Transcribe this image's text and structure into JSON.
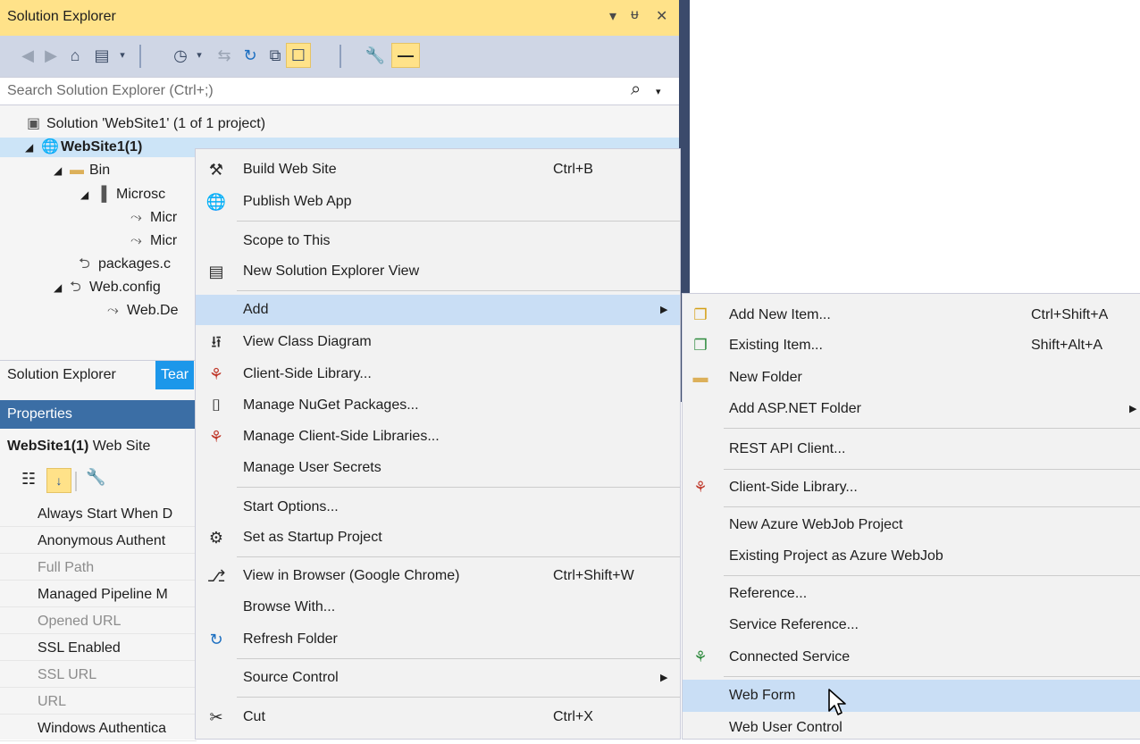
{
  "solution_explorer": {
    "title": "Solution Explorer",
    "title_controls": [
      "▾",
      "ᵽ",
      "✕"
    ],
    "search_placeholder": "Search Solution Explorer (Ctrl+;)",
    "tree": [
      {
        "label": "Solution 'WebSite1' (1 of 1 project)",
        "icon": "solution-icon"
      },
      {
        "label": "WebSite1(1)",
        "icon": "globe-icon",
        "bold": true,
        "expanded": true
      },
      {
        "label": "Bin",
        "icon": "folder-icon",
        "expanded": true
      },
      {
        "label": "Microsc",
        "icon": "library-icon",
        "expanded": true
      },
      {
        "label": "Micr",
        "icon": "file-ref-icon"
      },
      {
        "label": "Micr",
        "icon": "file-ref-icon"
      },
      {
        "label": "packages.c",
        "icon": "config-icon"
      },
      {
        "label": "Web.config",
        "icon": "config-icon",
        "expanded": true
      },
      {
        "label": "Web.De",
        "icon": "file-ref-icon"
      }
    ],
    "tabs": [
      "Solution Explorer",
      "Tear"
    ]
  },
  "properties": {
    "title": "Properties",
    "object_name": "WebSite1(1)",
    "object_type": "Web Site",
    "rows": [
      {
        "label": "Always Start When D",
        "enabled": true
      },
      {
        "label": "Anonymous Authent",
        "enabled": true
      },
      {
        "label": "Full Path",
        "enabled": false
      },
      {
        "label": "Managed Pipeline M",
        "enabled": true
      },
      {
        "label": "Opened URL",
        "enabled": false
      },
      {
        "label": "SSL Enabled",
        "enabled": true
      },
      {
        "label": "SSL URL",
        "enabled": false
      },
      {
        "label": "URL",
        "enabled": false
      },
      {
        "label": "Windows Authentica",
        "enabled": true
      }
    ]
  },
  "context_menu": {
    "items": [
      {
        "label": "Build Web Site",
        "shortcut": "Ctrl+B",
        "icon": "build-icon"
      },
      {
        "label": "Publish Web App",
        "shortcut": "",
        "icon": "publish-globe-icon"
      },
      {
        "label": "Scope to This",
        "shortcut": "",
        "icon": ""
      },
      {
        "label": "New Solution Explorer View",
        "shortcut": "",
        "icon": "new-view-icon"
      },
      {
        "label": "Add",
        "shortcut": "",
        "icon": "",
        "submenu": true,
        "highlighted": true
      },
      {
        "label": "View Class Diagram",
        "shortcut": "",
        "icon": "class-diagram-icon"
      },
      {
        "label": "Client-Side Library...",
        "shortcut": "",
        "icon": "client-library-icon"
      },
      {
        "label": "Manage NuGet Packages...",
        "shortcut": "",
        "icon": "nuget-icon"
      },
      {
        "label": "Manage Client-Side Libraries...",
        "shortcut": "",
        "icon": "client-library-icon"
      },
      {
        "label": "Manage User Secrets",
        "shortcut": "",
        "icon": ""
      },
      {
        "label": "Start Options...",
        "shortcut": "",
        "icon": ""
      },
      {
        "label": "Set as Startup Project",
        "shortcut": "",
        "icon": "gear-icon"
      },
      {
        "label": "View in Browser (Google Chrome)",
        "shortcut": "Ctrl+Shift+W",
        "icon": "browser-icon"
      },
      {
        "label": "Browse With...",
        "shortcut": "",
        "icon": ""
      },
      {
        "label": "Refresh Folder",
        "shortcut": "",
        "icon": "refresh-icon"
      },
      {
        "label": "Source Control",
        "shortcut": "",
        "icon": "",
        "submenu": true
      },
      {
        "label": "Cut",
        "shortcut": "Ctrl+X",
        "icon": "cut-icon"
      }
    ]
  },
  "add_submenu": {
    "items": [
      {
        "label": "Add New Item...",
        "shortcut": "Ctrl+Shift+A",
        "icon": "new-item-icon"
      },
      {
        "label": "Existing Item...",
        "shortcut": "Shift+Alt+A",
        "icon": "existing-item-icon"
      },
      {
        "label": "New Folder",
        "shortcut": "",
        "icon": "new-folder-icon"
      },
      {
        "label": "Add ASP.NET Folder",
        "shortcut": "",
        "icon": "",
        "submenu": true
      },
      {
        "label": "REST API Client...",
        "shortcut": "",
        "icon": ""
      },
      {
        "label": "Client-Side Library...",
        "shortcut": "",
        "icon": "client-library-icon"
      },
      {
        "label": "New Azure WebJob Project",
        "shortcut": "",
        "icon": ""
      },
      {
        "label": "Existing Project as Azure WebJob",
        "shortcut": "",
        "icon": ""
      },
      {
        "label": "Reference...",
        "shortcut": "",
        "icon": ""
      },
      {
        "label": "Service Reference...",
        "shortcut": "",
        "icon": ""
      },
      {
        "label": "Connected Service",
        "shortcut": "",
        "icon": "connected-service-icon"
      },
      {
        "label": "Web Form",
        "shortcut": "",
        "icon": "",
        "highlighted": true
      },
      {
        "label": "Web User Control",
        "shortcut": "",
        "icon": ""
      }
    ]
  },
  "colors": {
    "title_active": "#ffe289",
    "toolbar": "#cfd6e5",
    "selection": "#cce4f7",
    "menu_highlight": "#c9def5",
    "properties_title": "#3b6ea5"
  }
}
